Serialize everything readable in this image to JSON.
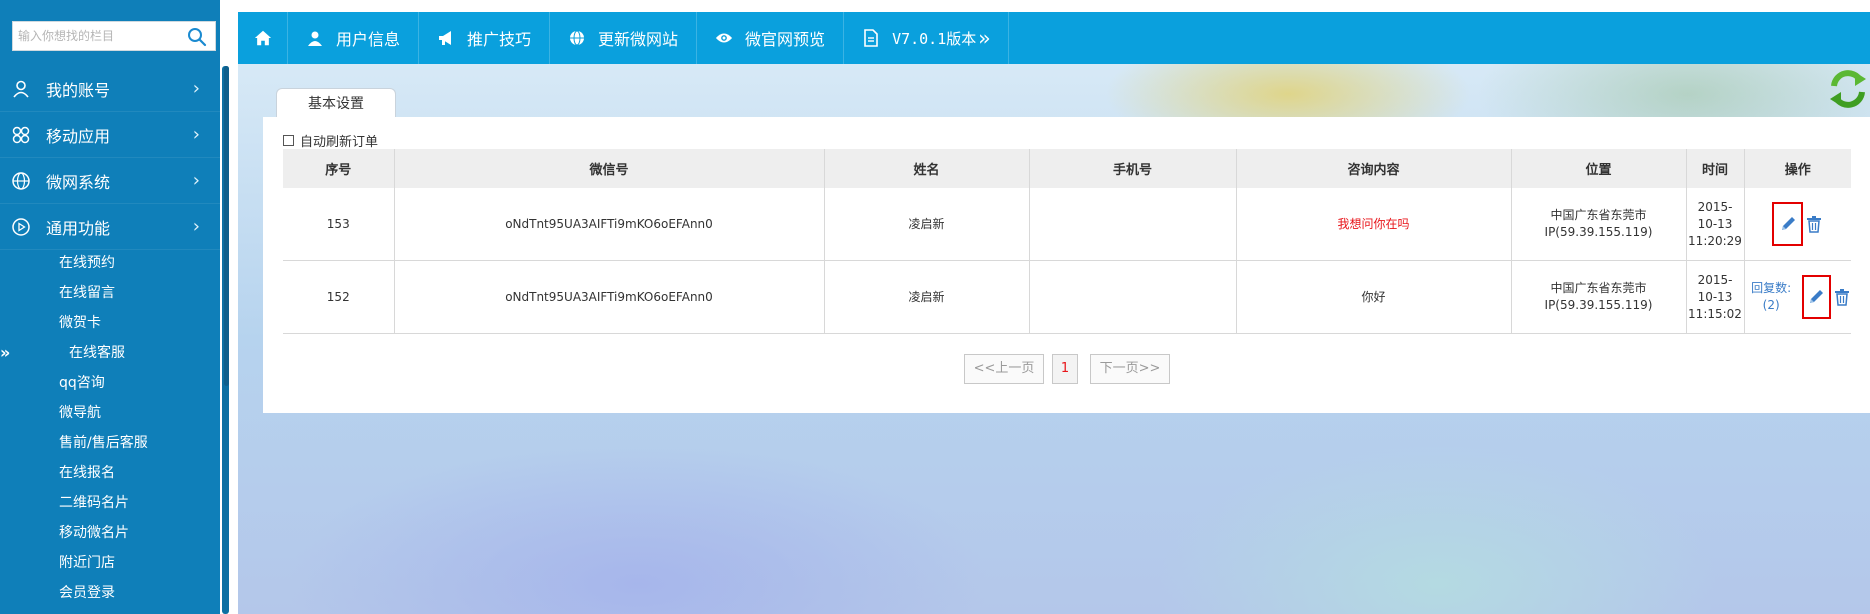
{
  "sidebar": {
    "search": {
      "placeholder": "输入你想找的栏目",
      "icon": "search-icon"
    },
    "menu": [
      {
        "label": "我的账号",
        "icon": "user-icon"
      },
      {
        "label": "移动应用",
        "icon": "apps-icon"
      },
      {
        "label": "微网系统",
        "icon": "globe-icon"
      },
      {
        "label": "通用功能",
        "icon": "play-circle-icon"
      }
    ],
    "submenu": [
      {
        "label": "在线预约"
      },
      {
        "label": "在线留言"
      },
      {
        "label": "微贺卡"
      },
      {
        "label": "在线客服",
        "active": true
      },
      {
        "label": "qq咨询"
      },
      {
        "label": "微导航"
      },
      {
        "label": "售前/售后客服"
      },
      {
        "label": "在线报名"
      },
      {
        "label": "二维码名片"
      },
      {
        "label": "移动微名片"
      },
      {
        "label": "附近门店"
      },
      {
        "label": "会员登录"
      }
    ]
  },
  "topnav": {
    "items": [
      {
        "label": "",
        "icon": "home-icon"
      },
      {
        "label": "用户信息",
        "icon": "user-icon"
      },
      {
        "label": "推广技巧",
        "icon": "megaphone-icon"
      },
      {
        "label": "更新微网站",
        "icon": "globe-icon"
      },
      {
        "label": "微官网预览",
        "icon": "eye-icon"
      },
      {
        "label": "V7.0.1版本",
        "icon": "document-icon"
      }
    ]
  },
  "content": {
    "tab_label": "基本设置",
    "auto_refresh_label": "自动刷新订单",
    "table": {
      "headers": [
        "序号",
        "微信号",
        "姓名",
        "手机号",
        "咨询内容",
        "位置",
        "时间",
        "操作"
      ],
      "rows": [
        {
          "id": "153",
          "wechat": "oNdTnt95UA3AIFTi9mKO6oEFAnn0",
          "name": "凌启新",
          "phone": "",
          "content": "我想问你在吗",
          "content_highlight": true,
          "location_line1": "中国广东省东莞市",
          "location_line2": "IP(59.39.155.119)",
          "date": "2015-",
          "date2": "10-13",
          "time": "11:20:29",
          "reply": ""
        },
        {
          "id": "152",
          "wechat": "oNdTnt95UA3AIFTi9mKO6oEFAnn0",
          "name": "凌启新",
          "phone": "",
          "content": "你好",
          "content_highlight": false,
          "location_line1": "中国广东省东莞市",
          "location_line2": "IP(59.39.155.119)",
          "date": "2015-",
          "date2": "10-13",
          "time": "11:15:02",
          "reply": "回复数:(2)"
        }
      ]
    },
    "pager": {
      "prev": "<<上一页",
      "current": "1",
      "next": "下一页>>"
    }
  },
  "colors": {
    "sidebar_bg": "#0f7fb9",
    "topnav_bg": "#0aa0dd",
    "highlight_red": "#e8141a",
    "link_blue": "#3a7cc7"
  }
}
